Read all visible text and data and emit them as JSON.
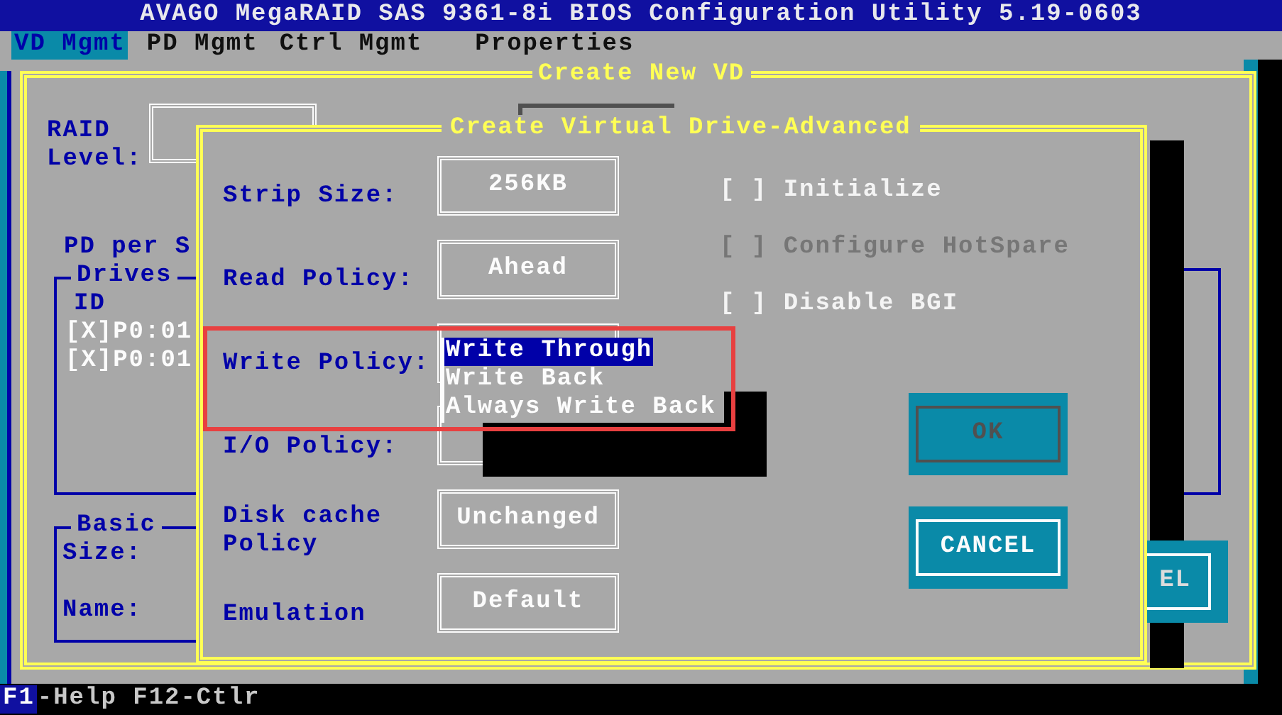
{
  "title_bar": {
    "text": "AVAGO MegaRAID SAS 9361-8i BIOS Configuration Utility 5.19-0603"
  },
  "menu": [
    {
      "label": "VD Mgmt",
      "selected": true
    },
    {
      "label": "PD Mgmt",
      "selected": false
    },
    {
      "label": "Ctrl Mgmt",
      "selected": false
    },
    {
      "label": "Properties",
      "selected": false
    }
  ],
  "create_vd": {
    "title": "Create New VD",
    "raid_level_label": "RAID Level:",
    "pd_per_span_label": "PD per S",
    "drives": {
      "title": "Drives",
      "column": "ID",
      "rows": [
        "[X]P0:01",
        "[X]P0:01"
      ]
    },
    "basic": {
      "title": "Basic",
      "fields": [
        "Size:",
        "Name:"
      ]
    },
    "partial_button": "EL"
  },
  "dialog": {
    "title": "Create Virtual Drive-Advanced",
    "fields": [
      {
        "label": "Strip Size:",
        "value": "256KB"
      },
      {
        "label": "Read Policy:",
        "value": "Ahead"
      },
      {
        "label": "Write Policy:",
        "dropdown": [
          {
            "label": "Write Through",
            "selected": true
          },
          {
            "label": "Write Back",
            "selected": false
          },
          {
            "label": "Always Write Back",
            "selected": false
          }
        ]
      },
      {
        "label": "I/O Policy:"
      },
      {
        "label": "Disk cache Policy",
        "value": "Unchanged"
      },
      {
        "label": "Emulation",
        "value": "Default"
      }
    ],
    "checkboxes": [
      {
        "box": "[ ]",
        "label": "Initialize",
        "disabled": false
      },
      {
        "box": "[ ]",
        "label": "Configure HotSpare",
        "disabled": true
      },
      {
        "box": "[ ]",
        "label": "Disable BGI",
        "disabled": false
      }
    ],
    "buttons": [
      {
        "label": "OK",
        "disabled": true
      },
      {
        "label": "CANCEL",
        "disabled": false
      }
    ]
  },
  "status_bar": {
    "key": "F1",
    "text": "-Help F12-Ctlr"
  }
}
